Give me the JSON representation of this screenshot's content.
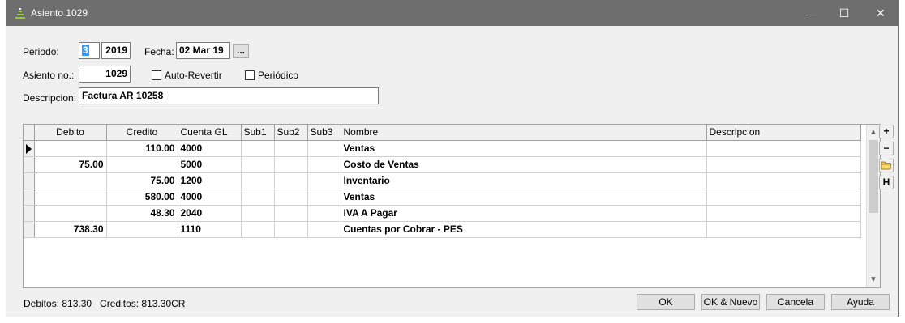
{
  "window": {
    "title": "Asiento 1029",
    "minimize": "—",
    "maximize": "☐",
    "close": "✕"
  },
  "form": {
    "periodo_label": "Periodo:",
    "periodo_value": "3",
    "year_value": "2019",
    "fecha_label": "Fecha:",
    "fecha_value": "02 Mar 19",
    "date_picker_label": "...",
    "asiento_label": "Asiento no.:",
    "asiento_value": "1029",
    "auto_revertir_label": "Auto-Revertir",
    "auto_revertir_checked": false,
    "periodico_label": "Periódico",
    "periodico_checked": false,
    "descripcion_label": "Descripcion:",
    "descripcion_value": "Factura AR 10258"
  },
  "grid": {
    "columns": [
      "Debito",
      "Credito",
      "Cuenta GL",
      "Sub1",
      "Sub2",
      "Sub3",
      "Nombre",
      "Descripcion"
    ],
    "rows": [
      {
        "current": true,
        "debito": "",
        "credito": "110.00",
        "cuenta": "4000",
        "sub1": "",
        "sub2": "",
        "sub3": "",
        "nombre": "Ventas",
        "descripcion": ""
      },
      {
        "debito": "75.00",
        "credito": "",
        "cuenta": "5000",
        "sub1": "",
        "sub2": "",
        "sub3": "",
        "nombre": "Costo de Ventas",
        "descripcion": ""
      },
      {
        "debito": "",
        "credito": "75.00",
        "cuenta": "1200",
        "sub1": "",
        "sub2": "",
        "sub3": "",
        "nombre": "Inventario",
        "descripcion": ""
      },
      {
        "debito": "",
        "credito": "580.00",
        "cuenta": "4000",
        "sub1": "",
        "sub2": "",
        "sub3": "",
        "nombre": "Ventas",
        "descripcion": ""
      },
      {
        "debito": "",
        "credito": "48.30",
        "cuenta": "2040",
        "sub1": "",
        "sub2": "",
        "sub3": "",
        "nombre": "IVA A Pagar",
        "descripcion": ""
      },
      {
        "debito": "738.30",
        "credito": "",
        "cuenta": "1110",
        "sub1": "",
        "sub2": "",
        "sub3": "",
        "nombre": "Cuentas por Cobrar - PES",
        "descripcion": ""
      }
    ]
  },
  "side_buttons": {
    "add": "+",
    "remove": "−",
    "folder_icon": "folder-icon",
    "history": "H"
  },
  "status": {
    "text": "Debitos: 813.30   Creditos: 813.30CR"
  },
  "buttons": {
    "ok": "OK",
    "ok_nuevo": "OK & Nuevo",
    "cancela": "Cancela",
    "ayuda": "Ayuda"
  },
  "colors": {
    "titlebar": "#6e6e6e",
    "selection": "#3399ff",
    "window_bg": "#f0f0f0"
  }
}
